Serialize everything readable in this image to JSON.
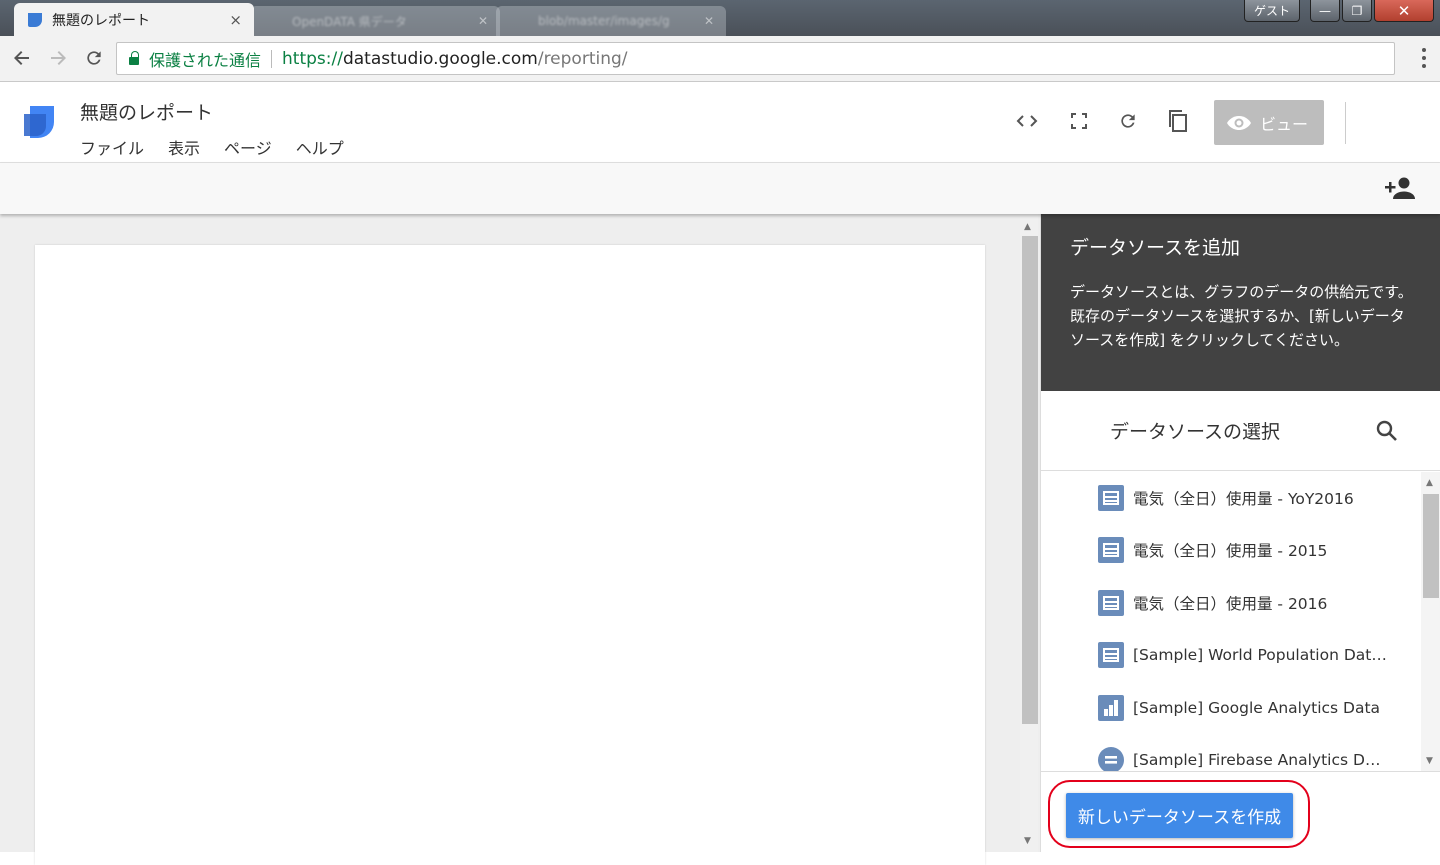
{
  "browser": {
    "active_tab_title": "無題のレポート",
    "tab_close": "×",
    "bg_tabs": [
      "OpenDATA 県データ",
      "blob/master/images/g"
    ],
    "window_buttons": {
      "guest": "ゲスト",
      "minimize": "—",
      "maximize": "❐",
      "close": "✕"
    },
    "secure_label": "保護された通信",
    "url_scheme": "https://",
    "url_host": "datastudio.google.com",
    "url_path": "/reporting/"
  },
  "app": {
    "report_title": "無題のレポート",
    "menu": [
      "ファイル",
      "表示",
      "ページ",
      "ヘルプ"
    ],
    "view_button": "ビュー",
    "accent_color": "#4285f4"
  },
  "panel": {
    "title": "データソースを追加",
    "description": "データソースとは、グラフのデータの供給元です。既存のデータソースを選択するか、[新しいデータソースを作成] をクリックしてください。",
    "section_title": "データソースの選択",
    "sources": [
      {
        "label": "電気（全日）使用量 - YoY2016",
        "icon": "sheets-icon"
      },
      {
        "label": "電気（全日）使用量 - 2015",
        "icon": "sheets-icon"
      },
      {
        "label": "電気（全日）使用量 - 2016",
        "icon": "sheets-icon"
      },
      {
        "label": "[Sample] World Population Data 2...",
        "icon": "sheets-icon"
      },
      {
        "label": "[Sample] Google Analytics Data",
        "icon": "analytics-icon"
      },
      {
        "label": "[Sample] Firebase Analytics Data ...",
        "icon": "firebase-icon"
      }
    ],
    "create_button": "新しいデータソースを作成",
    "highlight_color": "#e3001b"
  }
}
